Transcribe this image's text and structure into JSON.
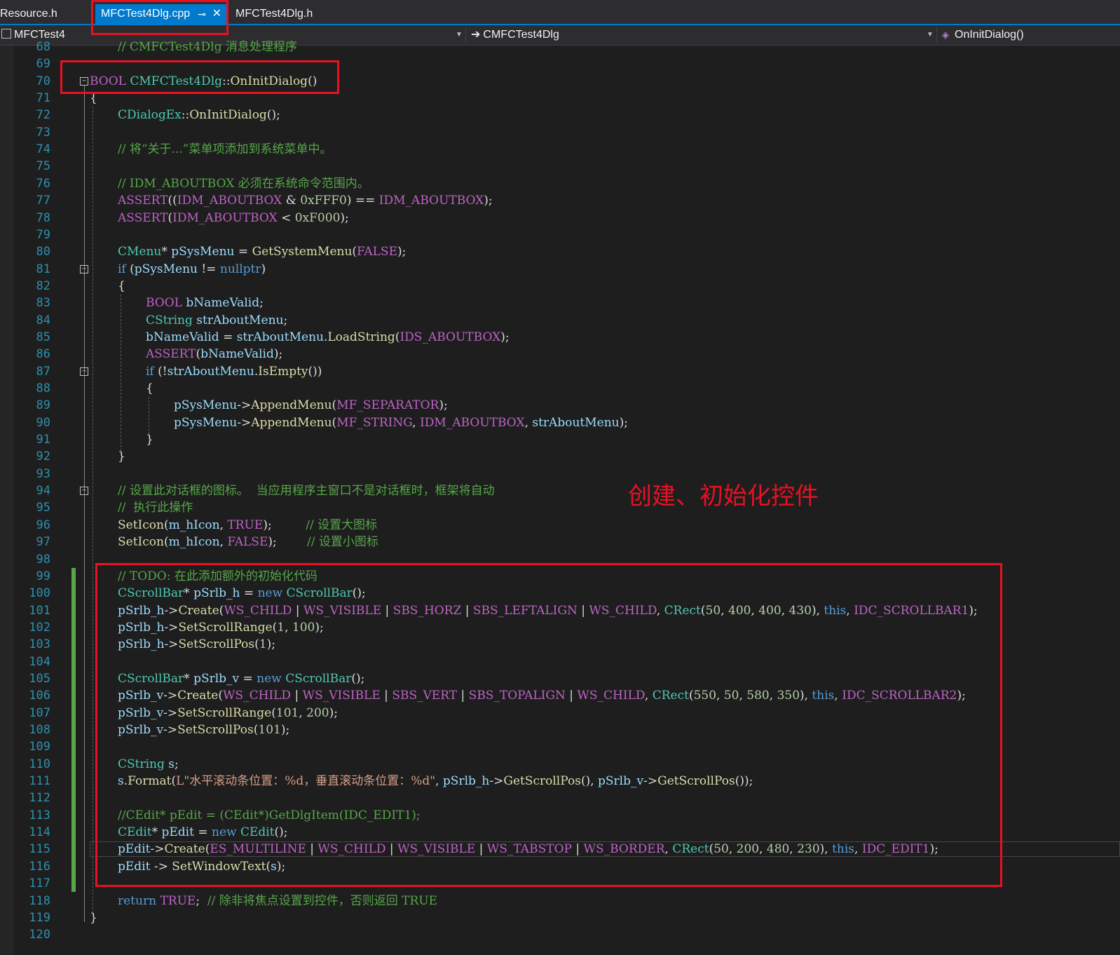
{
  "tabs": [
    {
      "label": "Resource.h"
    },
    {
      "label": "MFCTest4Dlg.cpp",
      "active": true,
      "pin_icon": "⊸",
      "close_icon": "✕"
    },
    {
      "label": "MFCTest4Dlg.h"
    }
  ],
  "nav": {
    "project": "MFCTest4",
    "class": "CMFCTest4Dlg",
    "method": "OnInitDialog()"
  },
  "annotation": "创建、初始化控件",
  "colors": {
    "keyword": "#569cd6",
    "type": "#4ec9b0",
    "function": "#dcdcaa",
    "comment": "#57a64a",
    "macro": "#bd63c5",
    "identifier": "#9cdcfe",
    "number": "#b5cea8",
    "string": "#d69d85",
    "accent": "#007acc",
    "highlight": "#e81123"
  },
  "code_lines": [
    {
      "n": "68",
      "t": "    // CMFCTest4Dlg 消息处理程序"
    },
    {
      "n": "69",
      "t": ""
    },
    {
      "n": "70",
      "t": "BOOL CMFCTest4Dlg::OnInitDialog()"
    },
    {
      "n": "71",
      "t": "{"
    },
    {
      "n": "72",
      "t": "    CDialogEx::OnInitDialog();"
    },
    {
      "n": "73",
      "t": ""
    },
    {
      "n": "74",
      "t": "    // 将“关于...”菜单项添加到系统菜单中。"
    },
    {
      "n": "75",
      "t": ""
    },
    {
      "n": "76",
      "t": "    // IDM_ABOUTBOX 必须在系统命令范围内。"
    },
    {
      "n": "77",
      "t": "    ASSERT((IDM_ABOUTBOX & 0xFFF0) == IDM_ABOUTBOX);"
    },
    {
      "n": "78",
      "t": "    ASSERT(IDM_ABOUTBOX < 0xF000);"
    },
    {
      "n": "79",
      "t": ""
    },
    {
      "n": "80",
      "t": "    CMenu* pSysMenu = GetSystemMenu(FALSE);"
    },
    {
      "n": "81",
      "t": "    if (pSysMenu != nullptr)"
    },
    {
      "n": "82",
      "t": "    {"
    },
    {
      "n": "83",
      "t": "        BOOL bNameValid;"
    },
    {
      "n": "84",
      "t": "        CString strAboutMenu;"
    },
    {
      "n": "85",
      "t": "        bNameValid = strAboutMenu.LoadString(IDS_ABOUTBOX);"
    },
    {
      "n": "86",
      "t": "        ASSERT(bNameValid);"
    },
    {
      "n": "87",
      "t": "        if (!strAboutMenu.IsEmpty())"
    },
    {
      "n": "88",
      "t": "        {"
    },
    {
      "n": "89",
      "t": "            pSysMenu->AppendMenu(MF_SEPARATOR);"
    },
    {
      "n": "90",
      "t": "            pSysMenu->AppendMenu(MF_STRING, IDM_ABOUTBOX, strAboutMenu);"
    },
    {
      "n": "91",
      "t": "        }"
    },
    {
      "n": "92",
      "t": "    }"
    },
    {
      "n": "93",
      "t": ""
    },
    {
      "n": "94",
      "t": "    // 设置此对话框的图标。  当应用程序主窗口不是对话框时，框架将自动"
    },
    {
      "n": "95",
      "t": "    //  执行此操作"
    },
    {
      "n": "96",
      "t": "    SetIcon(m_hIcon, TRUE);         // 设置大图标"
    },
    {
      "n": "97",
      "t": "    SetIcon(m_hIcon, FALSE);        // 设置小图标"
    },
    {
      "n": "98",
      "t": ""
    },
    {
      "n": "99",
      "t": "    // TODO: 在此添加额外的初始化代码"
    },
    {
      "n": "100",
      "t": "    CScrollBar* pSrlb_h = new CScrollBar();"
    },
    {
      "n": "101",
      "t": "    pSrlb_h->Create(WS_CHILD | WS_VISIBLE | SBS_HORZ | SBS_LEFTALIGN | WS_CHILD, CRect(50, 400, 400, 430), this, IDC_SCROLLBAR1);"
    },
    {
      "n": "102",
      "t": "    pSrlb_h->SetScrollRange(1, 100);"
    },
    {
      "n": "103",
      "t": "    pSrlb_h->SetScrollPos(1);"
    },
    {
      "n": "104",
      "t": ""
    },
    {
      "n": "105",
      "t": "    CScrollBar* pSrlb_v = new CScrollBar();"
    },
    {
      "n": "106",
      "t": "    pSrlb_v->Create(WS_CHILD | WS_VISIBLE | SBS_VERT | SBS_TOPALIGN | WS_CHILD, CRect(550, 50, 580, 350), this, IDC_SCROLLBAR2);"
    },
    {
      "n": "107",
      "t": "    pSrlb_v->SetScrollRange(101, 200);"
    },
    {
      "n": "108",
      "t": "    pSrlb_v->SetScrollPos(101);"
    },
    {
      "n": "109",
      "t": ""
    },
    {
      "n": "110",
      "t": "    CString s;"
    },
    {
      "n": "111",
      "t": "    s.Format(L\"水平滚动条位置：%d，垂直滚动条位置：%d\", pSrlb_h->GetScrollPos(), pSrlb_v->GetScrollPos());"
    },
    {
      "n": "112",
      "t": ""
    },
    {
      "n": "113",
      "t": "    //CEdit* pEdit = (CEdit*)GetDlgItem(IDC_EDIT1);"
    },
    {
      "n": "114",
      "t": "    CEdit* pEdit = new CEdit();"
    },
    {
      "n": "115",
      "t": "    pEdit->Create(ES_MULTILINE | WS_CHILD | WS_VISIBLE | WS_TABSTOP | WS_BORDER, CRect(50, 200, 480, 230), this, IDC_EDIT1);"
    },
    {
      "n": "116",
      "t": "    pEdit -> SetWindowText(s);"
    },
    {
      "n": "117",
      "t": ""
    },
    {
      "n": "118",
      "t": "    return TRUE;  // 除非将焦点设置到控件，否则返回 TRUE"
    },
    {
      "n": "119",
      "t": "}"
    },
    {
      "n": "120",
      "t": ""
    }
  ]
}
